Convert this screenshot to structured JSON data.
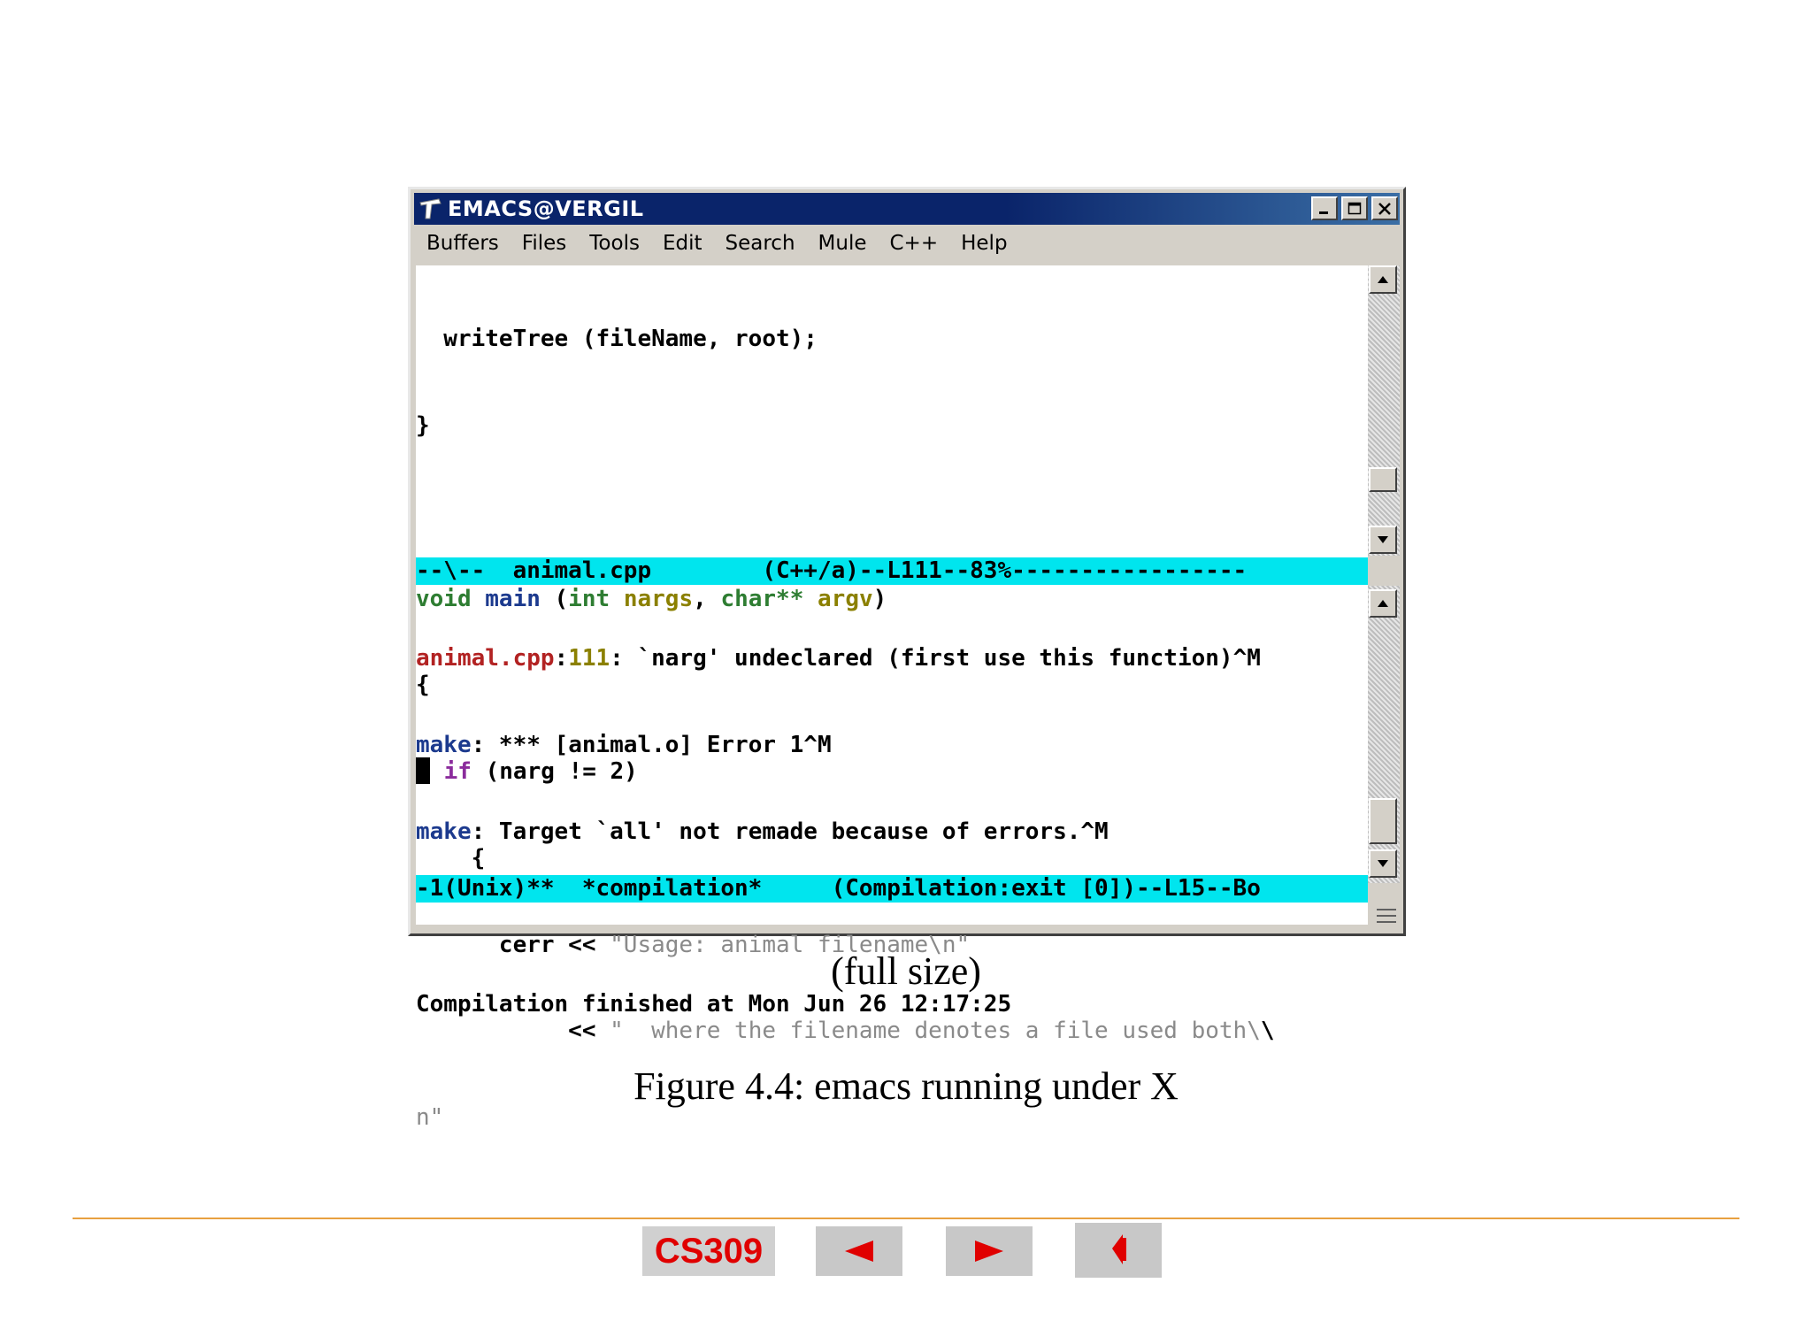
{
  "window": {
    "title": "EMACS@VERGIL",
    "menu": [
      "Buffers",
      "Files",
      "Tools",
      "Edit",
      "Search",
      "Mule",
      "C++",
      "Help"
    ]
  },
  "editor": {
    "l1": "  writeTree (fileName, root);",
    "l2": "}",
    "l4_void": "void",
    "l4_main": "main",
    "l4_p1": " (",
    "l4_int": "int",
    "l4_nargs": "nargs",
    "l4_char": "char**",
    "l4_argv": "argv",
    "l4_close": ")",
    "l5": "{",
    "l6_if": "if",
    "l6_rest": " (narg != 2)",
    "l7": "    {",
    "l8_a": "      cerr << ",
    "l8_str": "\"Usage: animal filename\\n\"",
    "l9_a": "           << ",
    "l9_str": "\"  where the filename denotes a file used both\\",
    "l9_bs": "\\",
    "l10": "n\"",
    "modeline": "--\\--  animal.cpp        (C++/a)--L111--83%-----------------"
  },
  "compilation": {
    "e1_file": "animal.cpp",
    "e1_line": "111",
    "e1_msg": ": `narg' undeclared (first use this function)^M",
    "e2_make": "make",
    "e2_msg": ": *** [animal.o] Error 1^M",
    "e3_make": "make",
    "e3_msg": ": Target `all' not remade because of errors.^M",
    "e5": "Compilation finished at Mon Jun 26 12:17:25",
    "modeline": "-1(Unix)**  *compilation*     (Compilation:exit [0])--L15--Bo"
  },
  "page": {
    "full_size": "(full size)",
    "figure": "Figure 4.4: emacs running under X",
    "course": "CS309"
  },
  "colors": {
    "modeline": "#00e5ee",
    "titlebar": "#0a246a",
    "nav_text": "#e00000",
    "rule": "#e8a040"
  }
}
